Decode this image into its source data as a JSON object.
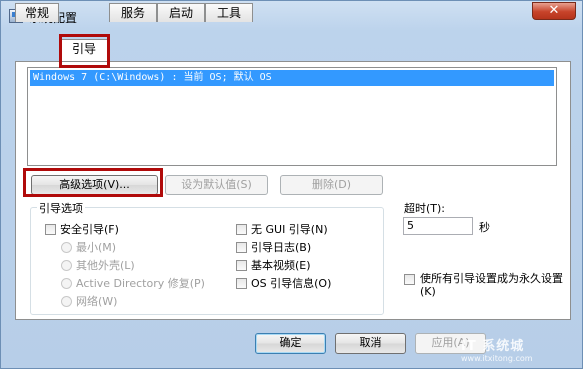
{
  "window": {
    "title": "系统配置",
    "close_label": "✕"
  },
  "tabs": [
    {
      "label": "常规"
    },
    {
      "label": "引导"
    },
    {
      "label": "服务"
    },
    {
      "label": "启动"
    },
    {
      "label": "工具"
    }
  ],
  "boot_list": {
    "items": [
      "Windows 7 (C:\\Windows) : 当前 OS; 默认 OS"
    ]
  },
  "list_buttons": {
    "advanced": "高级选项(V)...",
    "set_default": "设为默认值(S)",
    "delete": "删除(D)"
  },
  "boot_options": {
    "title": "引导选项",
    "safe_boot": "安全引导(F)",
    "minimal": "最小(M)",
    "alternate_shell": "其他外壳(L)",
    "ad_repair": "Active Directory 修复(P)",
    "network": "网络(W)",
    "no_gui": "无 GUI 引导(N)",
    "boot_log": "引导日志(B)",
    "base_video": "基本视频(E)",
    "os_info": "OS 引导信息(O)"
  },
  "timeout": {
    "label": "超时(T):",
    "value": "5",
    "unit": "秒"
  },
  "persist": {
    "label": "使所有引导设置成为永久设置(K)"
  },
  "footer_buttons": {
    "ok": "确定",
    "cancel": "取消",
    "apply": "应用(A)"
  },
  "watermark": {
    "text": "IT 系统城",
    "sub": "www.itxitong.com"
  },
  "colors": {
    "selection": "#3399ff",
    "highlight_box": "#b00a0a",
    "window_frame": "#b7cee8"
  }
}
